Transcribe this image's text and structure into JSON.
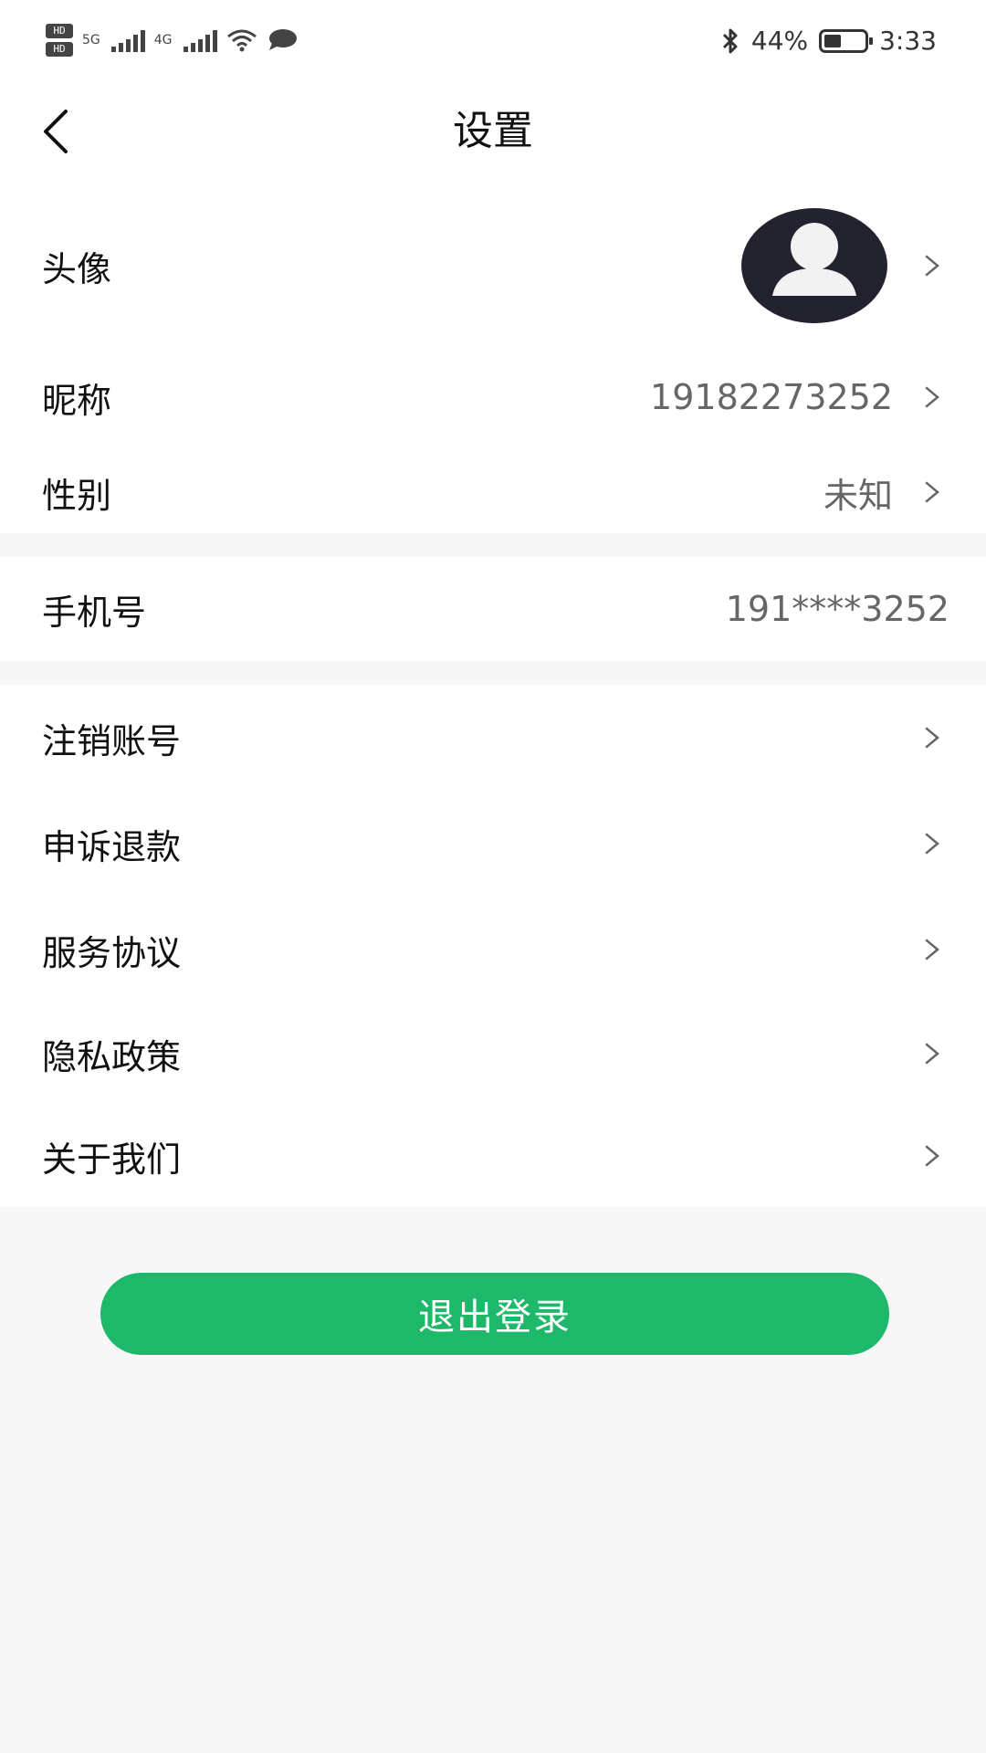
{
  "status_bar": {
    "hd1": "HD",
    "hd2": "HD",
    "net1": "5G",
    "net2": "4G",
    "battery_percent_text": "44%",
    "battery_level": 0.44,
    "time": "3:33"
  },
  "header": {
    "title": "设置"
  },
  "profile": {
    "avatar_label": "头像",
    "nickname_label": "昵称",
    "nickname_value": "19182273252",
    "gender_label": "性别",
    "gender_value": "未知"
  },
  "account": {
    "phone_label": "手机号",
    "phone_value": "191****3252"
  },
  "menu": {
    "items": [
      {
        "label": "注销账号"
      },
      {
        "label": "申诉退款"
      },
      {
        "label": "服务协议"
      },
      {
        "label": "隐私政策"
      },
      {
        "label": "关于我们"
      }
    ]
  },
  "logout": {
    "label": "退出登录"
  },
  "colors": {
    "accent": "#1db86a",
    "background": "#f7f7f7",
    "avatar_bg": "#23222f"
  },
  "icons": {
    "back": "back-arrow-icon",
    "chevron": "chevron-right-icon",
    "avatar": "user-icon",
    "bluetooth": "bluetooth-icon",
    "wifi": "wifi-icon",
    "message": "message-bubble-icon",
    "battery": "battery-icon"
  }
}
